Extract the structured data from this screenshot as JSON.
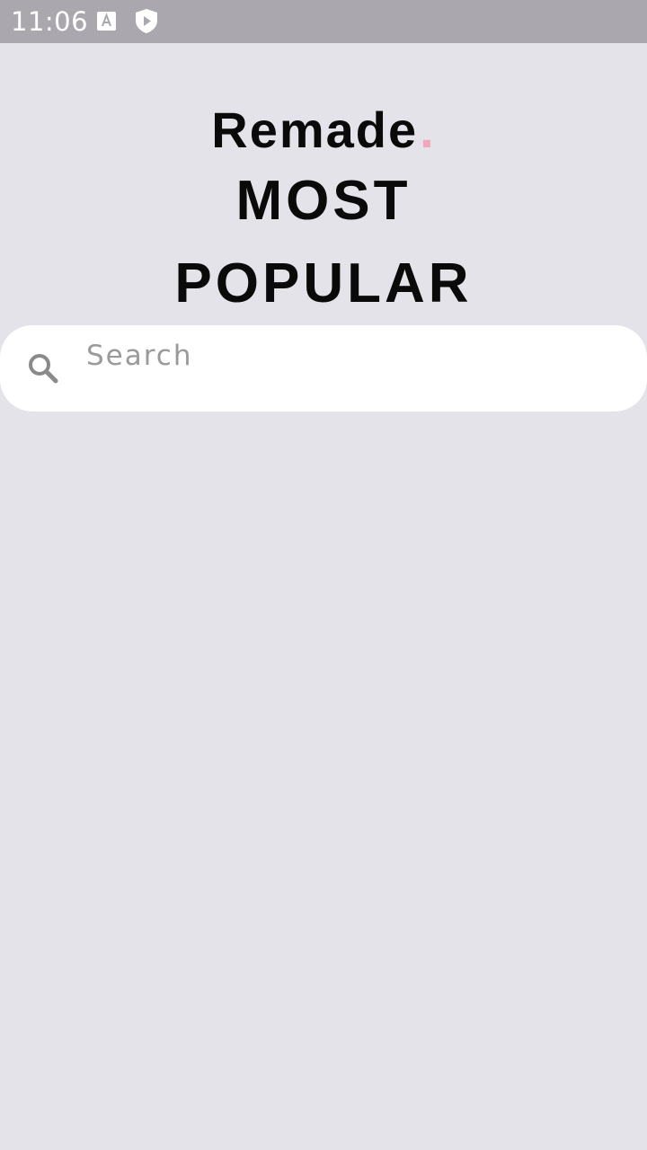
{
  "status_bar": {
    "time": "11:06",
    "icons": [
      "a-font-icon",
      "shield-play-icon"
    ]
  },
  "header": {
    "brand": "Remade",
    "brand_dot": ".",
    "title_line1": "MOST",
    "title_line2": "POPULAR"
  },
  "search": {
    "placeholder": "Search",
    "value": "",
    "icon": "search-icon"
  },
  "colors": {
    "background": "#e5e3ea",
    "status_bar": "#aaa8ae",
    "accent_dot": "#f2a7b8",
    "search_bg": "#ffffff"
  }
}
